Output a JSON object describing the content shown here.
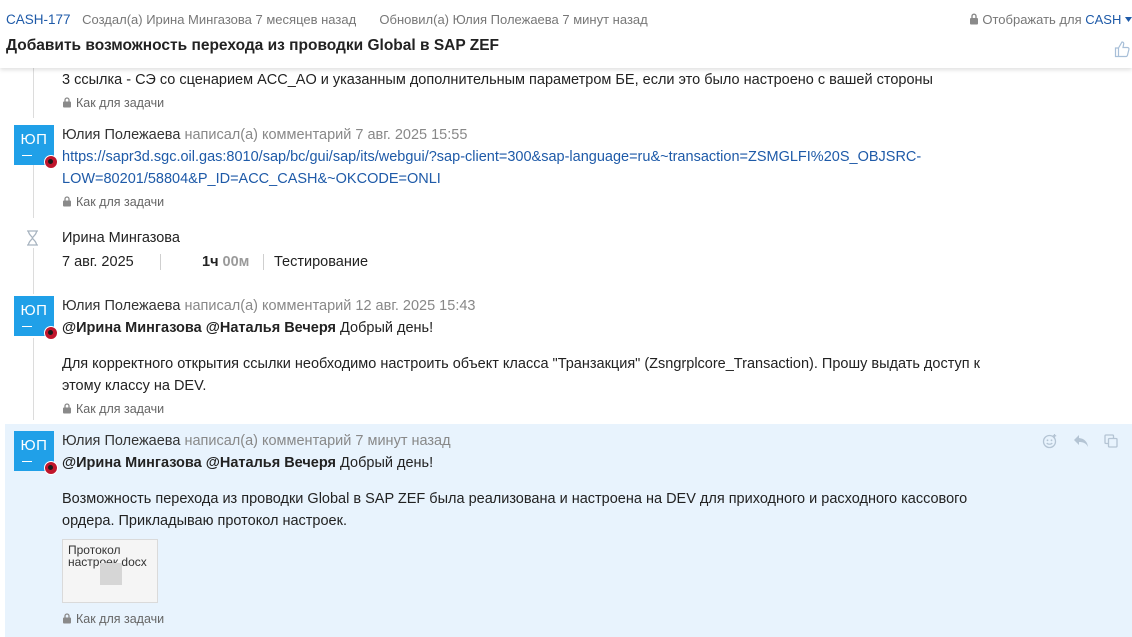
{
  "header": {
    "issue_key": "CASH-177",
    "created": "Создал(а) Ирина Мингазова 7 месяцев назад",
    "updated": "Обновил(а) Юлия Полежаева 7 минут назад",
    "visibility_label": "Отображать для",
    "visibility_value": "CASH",
    "title": "Добавить возможность перехода из проводки Global в SAP ZEF"
  },
  "feed": {
    "top_text": "3 ссылка - СЭ со сценарием ACC_AO и указанным дополнительным параметром БЕ, если это было настроено с вашей стороны",
    "top_privacy": "Как для задачи",
    "comment1": {
      "avatar": "ЮП",
      "author": "Юлия Полежаева",
      "action": "написал(а) комментарий 7 авг. 2025 15:55",
      "link_line1": "https://sapr3d.sgc.oil.gas:8010/sap/bc/gui/sap/its/webgui/?sap-client=300&sap-language=ru&~transaction=ZSMGLFI%20S_OBJSRC-",
      "link_line2": "LOW=80201/58804&P_ID=ACC_CASH&~OKCODE=ONLI",
      "privacy": "Как для задачи"
    },
    "worklog": {
      "author": "Ирина Мингазова",
      "date": "7 авг. 2025",
      "hours": "1ч",
      "minutes": "00м",
      "status": "Тестирование"
    },
    "comment2": {
      "avatar": "ЮП",
      "author": "Юлия Полежаева",
      "action": "написал(а) комментарий 12 авг. 2025 15:43",
      "mention1": "@Ирина Мингазова",
      "mention2": "@Наталья Вечеря",
      "greeting": "Добрый день!",
      "body_line1": "Для корректного открытия ссылки необходимо настроить объект класса \"Транзакция\" (Zsngrplcore_Transaction). Прошу выдать доступ к",
      "body_line2": "этому классу на DEV.",
      "privacy": "Как для задачи"
    },
    "comment3": {
      "avatar": "ЮП",
      "author": "Юлия Полежаева",
      "action": "написал(а) комментарий 7 минут назад",
      "mention1": "@Ирина Мингазова",
      "mention2": "@Наталья Вечеря",
      "greeting": "Добрый день!",
      "body_line1": "Возможность перехода из проводки Global в SAP ZEF была реализована и настроена на DEV для приходного и расходного кассового",
      "body_line2": "ордера. Прикладываю протокол настроек.",
      "attachment_name": "Протокол настроек.docx",
      "privacy": "Как для задачи"
    }
  },
  "icons": [
    "lock-icon",
    "chevron-down-icon",
    "like-icon",
    "hourglass-icon",
    "emoji-icon",
    "reply-icon",
    "copy-icon"
  ],
  "colors": {
    "link": "#1e5aa8",
    "avatar": "#20a0e8",
    "highlight": "#e8f3fd"
  }
}
